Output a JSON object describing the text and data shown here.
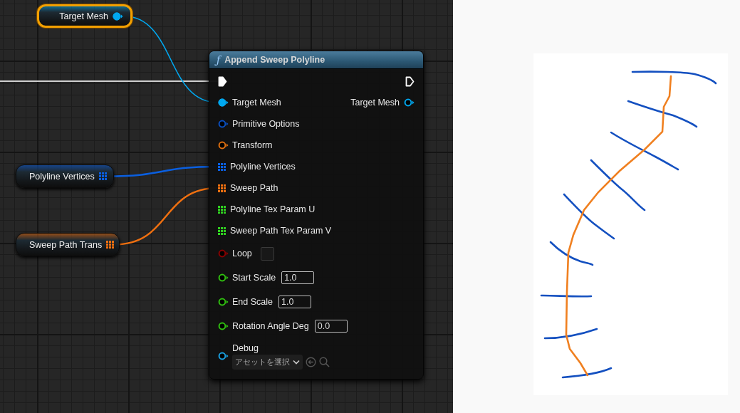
{
  "graph": {
    "variables": [
      {
        "label": "Target Mesh",
        "kind": "circle",
        "color": "#00a8f0",
        "selected": true
      },
      {
        "label": "Polyline Vertices",
        "kind": "grid",
        "color": "#0a5fe0",
        "selected": false
      },
      {
        "label": "Sweep Path Trans",
        "kind": "grid",
        "color": "#f07010",
        "selected": false
      }
    ],
    "node": {
      "icon_glyph": "ƒ",
      "title": "Append Sweep Polyline",
      "exec_in": {
        "connected": true
      },
      "exec_out": {
        "connected": false
      },
      "inputs": [
        {
          "label": "Target Mesh",
          "kind": "circle",
          "color": "#00a8f0",
          "connected": true
        },
        {
          "label": "Primitive Options",
          "kind": "circle",
          "color": "#0a4fc0",
          "connected": false
        },
        {
          "label": "Transform",
          "kind": "circle",
          "color": "#e07010",
          "connected": false
        },
        {
          "label": "Polyline Vertices",
          "kind": "grid",
          "color": "#0a5fe0",
          "connected": true
        },
        {
          "label": "Sweep Path",
          "kind": "grid",
          "color": "#f07010",
          "connected": true
        },
        {
          "label": "Polyline Tex Param U",
          "kind": "grid",
          "color": "#30d020",
          "connected": false
        },
        {
          "label": "Sweep Path Tex Param V",
          "kind": "grid",
          "color": "#30d020",
          "connected": false
        },
        {
          "label": "Loop",
          "kind": "circle",
          "color": "#8a0000",
          "connected": false,
          "checked": false
        },
        {
          "label": "Start Scale",
          "kind": "circle",
          "color": "#30c010",
          "connected": false,
          "value": "1.0"
        },
        {
          "label": "End Scale",
          "kind": "circle",
          "color": "#30c010",
          "connected": false,
          "value": "1.0"
        },
        {
          "label": "Rotation Angle Deg",
          "kind": "circle",
          "color": "#30c010",
          "connected": false,
          "value": "0.0"
        },
        {
          "label": "Debug",
          "kind": "circle",
          "color": "#1aa0e0",
          "connected": false,
          "picker": "アセットを選択"
        }
      ],
      "outputs": [
        {
          "label": "Target Mesh",
          "kind": "circle",
          "color": "#00a8f0",
          "connected": false
        }
      ]
    }
  }
}
